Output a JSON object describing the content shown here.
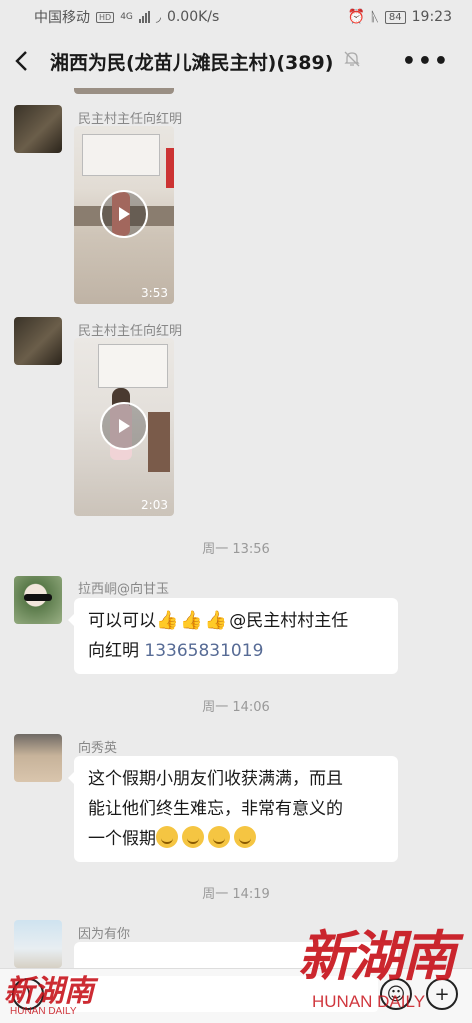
{
  "status": {
    "carrier": "中国移动",
    "hd": "HD",
    "network": "4G",
    "speed": "0.00K/s",
    "battery": "84",
    "time": "19:23"
  },
  "header": {
    "title": "湘西为民(龙苗儿滩民主村)(389)"
  },
  "messages": [
    {
      "sender": "民主村主任向红明",
      "duration": "3:53"
    },
    {
      "sender": "民主村主任向红明",
      "duration": "2:03"
    }
  ],
  "dividers": [
    "周一 13:56",
    "周一 14:06",
    "周一 14:19"
  ],
  "text_msgs": [
    {
      "sender": "拉西峒@向甘玉",
      "line1": "可以可以",
      "mention": "@民主村村主任",
      "line2": "向红明 ",
      "phone": "13365831019"
    },
    {
      "sender": "向秀英",
      "line1": "这个假期小朋友们收获满满，而且",
      "line2": "能让他们终生难忘，非常有意义的",
      "line3": "一个假期"
    },
    {
      "sender": "因为有你"
    }
  ],
  "watermark": {
    "big": "新湖南",
    "en": "HUNAN DAILY"
  },
  "icons": [
    "back-icon",
    "mute-icon",
    "more-icon",
    "play-icon",
    "voice-icon",
    "emoji-icon",
    "plus-icon"
  ]
}
